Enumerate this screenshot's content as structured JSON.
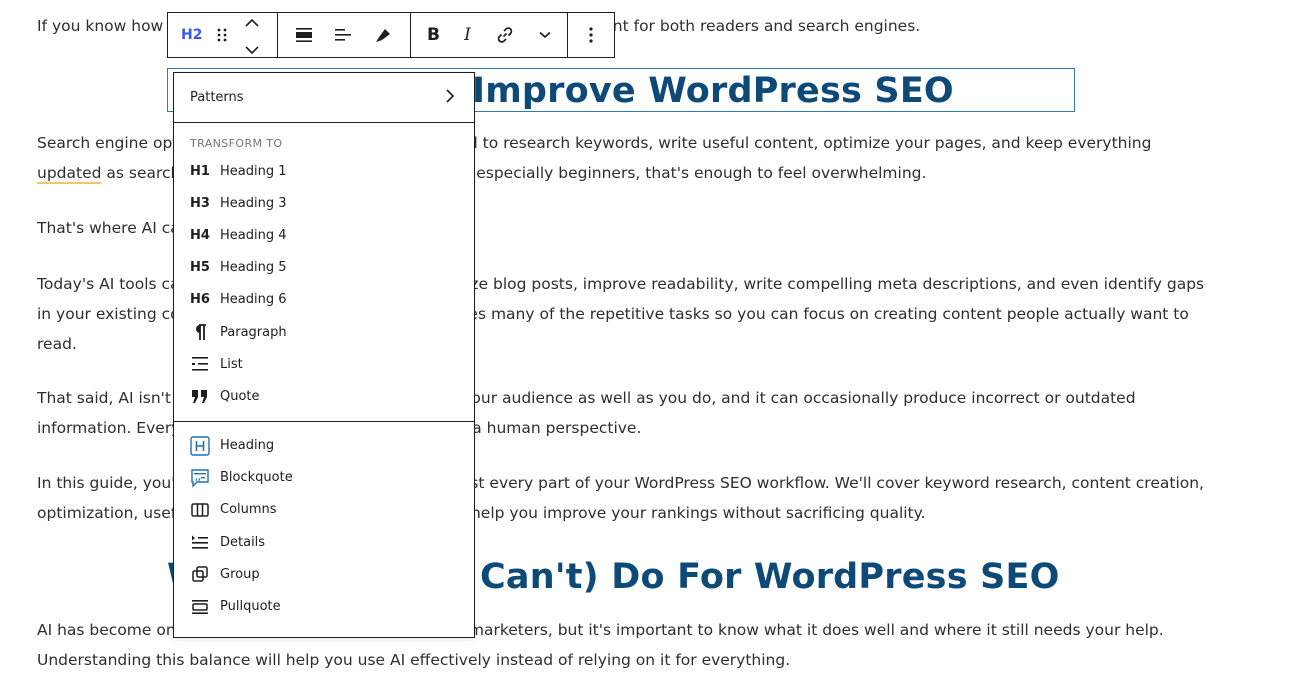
{
  "content": {
    "p_intro": "If you know how to use AI the right way, it can help you build better content for both readers and search engines.",
    "heading1_visible": "Improve WordPress SEO",
    "p1_a": "Search engine optimization takes a lot of work. You need to research keywords, write useful content, optimize your pages, and keep everything ",
    "p1_flagged": "updated",
    "p1_b": " as search trends change. For busy site owners, especially beginners, that's enough to feel overwhelming.",
    "p2": "That's where AI can help.",
    "p3": "Today's AI tools can help you research keywords, optimize blog posts, improve readability, write compelling meta descriptions, and even identify gaps in your existing content. Using AI for these tasks removes many of the repetitive tasks so you can focus on creating content people actually want to read.",
    "p4": "That said, AI isn't a replacement for you. It can't know your audience as well as you do, and it can occasionally produce incorrect or outdated information. Every suggestion should be reviewed from a human perspective.",
    "p5": "In this guide, you'll learn how to use AI to improve almost every part of your WordPress SEO workflow. We'll cover keyword research, content creation, optimization, useful AI tools, and practical tips that can help you improve your rankings without sacrificing quality.",
    "heading2_left": "W",
    "heading2_right": "Can't) Do For WordPress SEO",
    "p6": "AI has become one of the most useful tools for content marketers, but it's important to know what it does well and where it still needs your help. Understanding this balance will help you use AI effectively instead of relying on it for everything."
  },
  "toolbar": {
    "block_type": "H2",
    "drag_icon": "drag-handle-icon",
    "move_icons": [
      "chevron-up-icon",
      "chevron-down-icon"
    ],
    "align_icon": "align-wide-icon",
    "text_align_icon": "text-align-icon",
    "highlight_icon": "highlighter-icon",
    "bold_icon": "bold-icon",
    "italic_icon": "italic-icon",
    "link_icon": "link-icon",
    "more_format_icon": "chevron-down-icon",
    "options_icon": "more-vertical-icon"
  },
  "menu": {
    "patterns_label": "Patterns",
    "section_title": "TRANSFORM TO",
    "transform_items": [
      {
        "icon": "H1",
        "label": "Heading 1"
      },
      {
        "icon": "H3",
        "label": "Heading 3"
      },
      {
        "icon": "H4",
        "label": "Heading 4"
      },
      {
        "icon": "H5",
        "label": "Heading 5"
      },
      {
        "icon": "H6",
        "label": "Heading 6"
      },
      {
        "icon": "paragraph-icon",
        "label": "Paragraph"
      },
      {
        "icon": "list-icon",
        "label": "List"
      },
      {
        "icon": "quote-icon",
        "label": "Quote"
      }
    ],
    "block_items": [
      {
        "icon": "heading-block-icon",
        "label": "Heading"
      },
      {
        "icon": "blockquote-icon",
        "label": "Blockquote"
      },
      {
        "icon": "columns-icon",
        "label": "Columns"
      },
      {
        "icon": "details-icon",
        "label": "Details"
      },
      {
        "icon": "group-icon",
        "label": "Group"
      },
      {
        "icon": "pullquote-icon",
        "label": "Pullquote"
      }
    ]
  },
  "colors": {
    "heading": "#0d4a78",
    "selection_border": "#2f7cad",
    "spell_underline": "#f0c46a",
    "heading_block_icon": "#2271b1"
  }
}
